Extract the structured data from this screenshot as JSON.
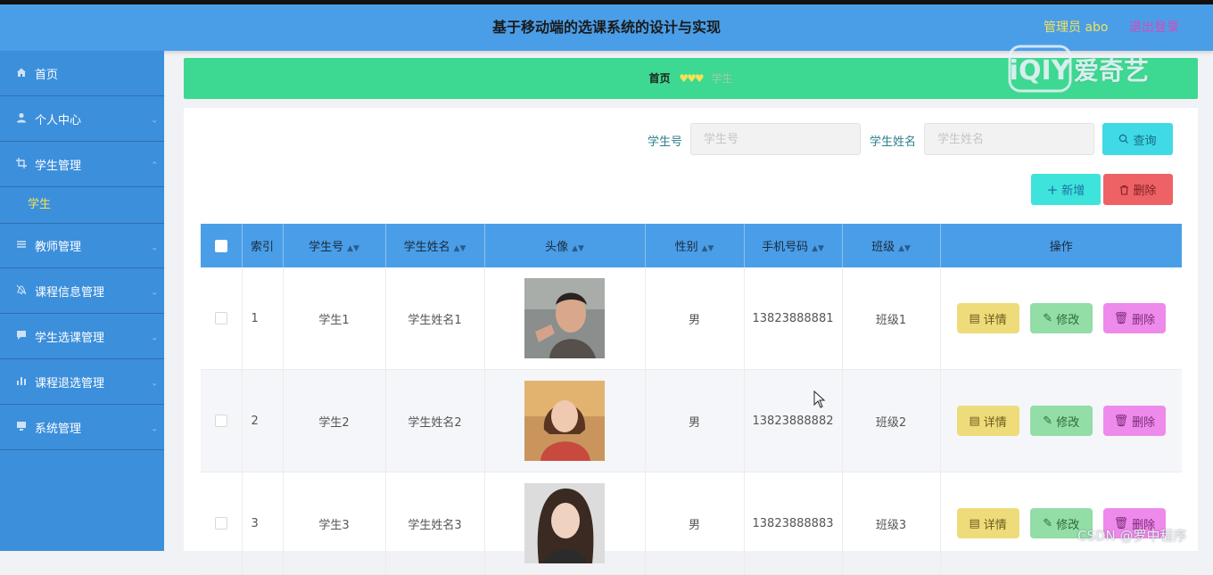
{
  "header": {
    "title": "基于移动端的选课系统的设计与实现",
    "admin_label": "管理员 abo",
    "logout_label": "退出登录"
  },
  "sidebar": {
    "items": [
      {
        "label": "首页",
        "icon": "home-icon"
      },
      {
        "label": "个人中心",
        "icon": "user-icon"
      },
      {
        "label": "学生管理",
        "icon": "crop-icon"
      },
      {
        "label": "教师管理",
        "icon": "list-icon"
      },
      {
        "label": "课程信息管理",
        "icon": "bell-icon"
      },
      {
        "label": "学生选课管理",
        "icon": "chat-icon"
      },
      {
        "label": "课程退选管理",
        "icon": "bar-chart-icon"
      },
      {
        "label": "系统管理",
        "icon": "monitor-icon"
      }
    ],
    "active_sub_item": "学生"
  },
  "breadcrumb": {
    "home": "首页",
    "current": "学生"
  },
  "search": {
    "student_no_label": "学生号",
    "student_no_placeholder": "学生号",
    "student_name_label": "学生姓名",
    "student_name_placeholder": "学生姓名",
    "query_label": "查询"
  },
  "toolbar": {
    "add_label": "新增",
    "delete_label": "删除"
  },
  "table": {
    "columns": [
      "索引",
      "学生号",
      "学生姓名",
      "头像",
      "性别",
      "手机号码",
      "班级",
      "操作"
    ],
    "rows": [
      {
        "index": "1",
        "student_no": "学生1",
        "student_name": "学生姓名1",
        "gender": "男",
        "phone": "13823888881",
        "class": "班级1"
      },
      {
        "index": "2",
        "student_no": "学生2",
        "student_name": "学生姓名2",
        "gender": "男",
        "phone": "13823888882",
        "class": "班级2"
      },
      {
        "index": "3",
        "student_no": "学生3",
        "student_name": "学生姓名3",
        "gender": "男",
        "phone": "13823888883",
        "class": "班级3"
      }
    ],
    "actions": {
      "detail": "详情",
      "edit": "修改",
      "delete": "删除"
    }
  },
  "overlays": {
    "watermark_text": "爱奇艺",
    "watermark_logo": "iQIY",
    "csdn_text": "CSDN @罗中程序"
  },
  "colors": {
    "header": "#4a9ee8",
    "sidebar": "#3c8fdb",
    "breadcrumb": "#3dd891",
    "accent_yellow": "#f3e25a"
  }
}
